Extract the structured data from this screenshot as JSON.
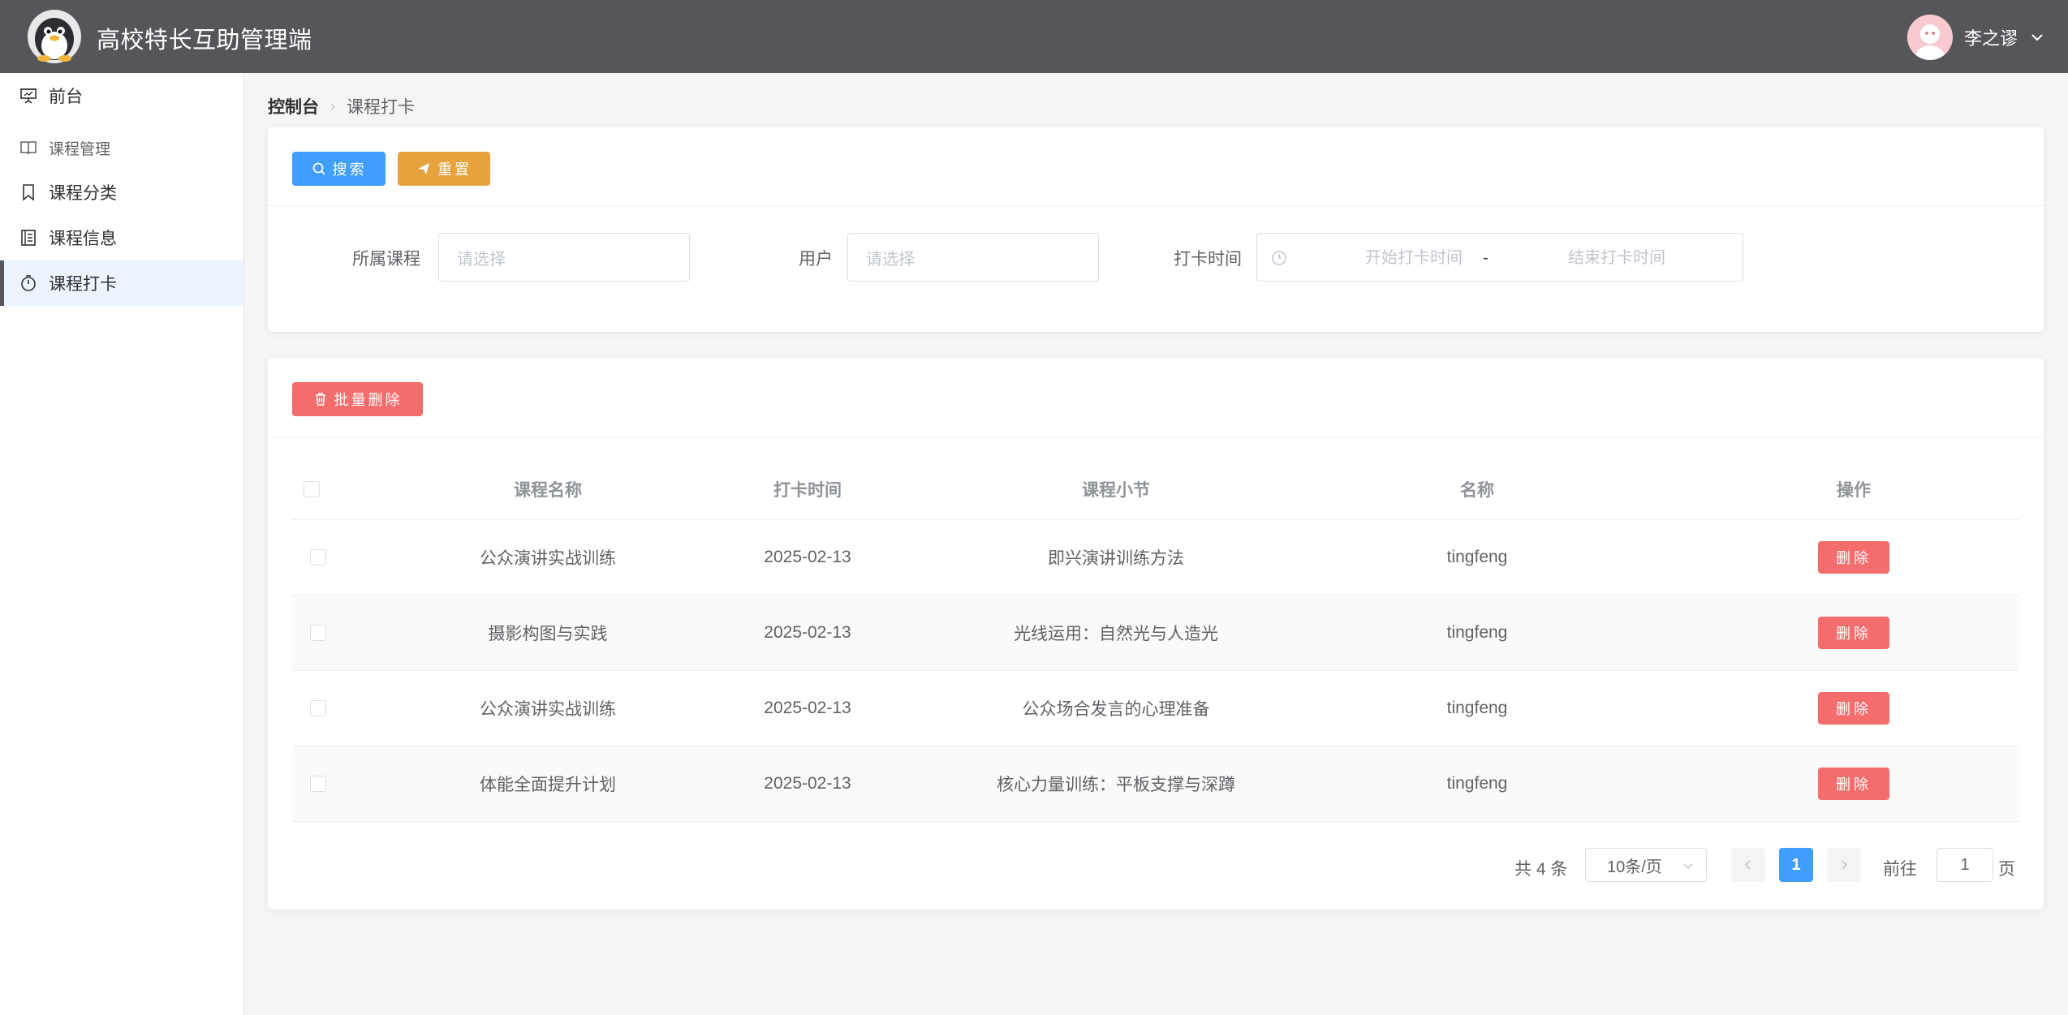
{
  "header": {
    "app_title": "高校特长互助管理端",
    "user_name": "李之谬"
  },
  "sidebar": {
    "items": [
      {
        "label": "前台",
        "icon": "presentation-icon"
      },
      {
        "label": "课程管理",
        "icon": "book-icon",
        "group": true
      },
      {
        "label": "课程分类",
        "icon": "bookmark-icon"
      },
      {
        "label": "课程信息",
        "icon": "notebook-icon"
      },
      {
        "label": "课程打卡",
        "icon": "stopwatch-icon",
        "active": true
      }
    ]
  },
  "breadcrumb": {
    "home": "控制台",
    "current": "课程打卡"
  },
  "search": {
    "search_label": "搜索",
    "reset_label": "重置",
    "course_label": "所属课程",
    "course_placeholder": "请选择",
    "user_label": "用户",
    "user_placeholder": "请选择",
    "time_label": "打卡时间",
    "start_placeholder": "开始打卡时间",
    "range_separator": "-",
    "end_placeholder": "结束打卡时间"
  },
  "toolbar": {
    "batch_delete_label": "批量删除"
  },
  "table": {
    "columns": [
      "课程名称",
      "打卡时间",
      "课程小节",
      "名称",
      "操作"
    ],
    "rows": [
      {
        "course": "公众演讲实战训练",
        "time": "2025-02-13",
        "section": "即兴演讲训练方法",
        "user": "tingfeng",
        "action": "删除"
      },
      {
        "course": "摄影构图与实践",
        "time": "2025-02-13",
        "section": "光线运用：自然光与人造光",
        "user": "tingfeng",
        "action": "删除"
      },
      {
        "course": "公众演讲实战训练",
        "time": "2025-02-13",
        "section": "公众场合发言的心理准备",
        "user": "tingfeng",
        "action": "删除"
      },
      {
        "course": "体能全面提升计划",
        "time": "2025-02-13",
        "section": "核心力量训练：平板支撑与深蹲",
        "user": "tingfeng",
        "action": "删除"
      }
    ]
  },
  "pagination": {
    "total": "共 4 条",
    "page_size": "10条/页",
    "current_page": "1",
    "goto_label": "前往",
    "goto_value": "1",
    "goto_suffix": "页"
  },
  "colors": {
    "header_bg": "#545659",
    "primary": "#409eff",
    "warning": "#e6a23c",
    "danger": "#f56c6c"
  }
}
